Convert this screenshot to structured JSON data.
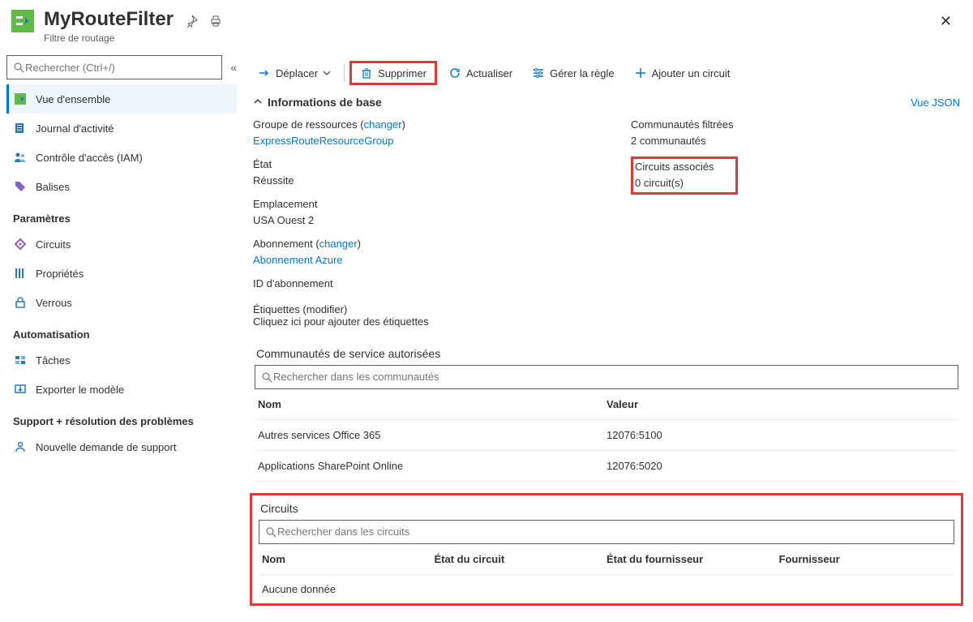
{
  "header": {
    "title": "MyRouteFilter",
    "subtitle": "Filtre de routage"
  },
  "sidebar": {
    "search_placeholder": "Rechercher (Ctrl+/)",
    "items": {
      "overview": "Vue d'ensemble",
      "activity": "Journal d'activité",
      "iam": "Contrôle d'accès (IAM)",
      "tags": "Balises"
    },
    "section_params": "Paramètres",
    "params": {
      "circuits": "Circuits",
      "properties": "Propriétés",
      "locks": "Verrous"
    },
    "section_auto": "Automatisation",
    "auto": {
      "tasks": "Tâches",
      "export": "Exporter le modèle"
    },
    "section_support": "Support + résolution des problèmes",
    "support": {
      "new": "Nouvelle demande de support"
    }
  },
  "toolbar": {
    "move": "Déplacer",
    "delete": "Supprimer",
    "refresh": "Actualiser",
    "manage_rule": "Gérer la règle",
    "add_circuit": "Ajouter un circuit"
  },
  "essentials": {
    "title": "Informations de base",
    "json_link": "Vue JSON",
    "rg_label": "Groupe de ressources (",
    "rg_change": "changer",
    "rg_close": ")",
    "rg_value": "ExpressRouteResourceGroup",
    "state_label": "État",
    "state_value": "Réussite",
    "location_label": "Emplacement",
    "location_value": "USA Ouest 2",
    "sub_label": "Abonnement (",
    "sub_change": "changer",
    "sub_close": ")",
    "sub_value": "Abonnement Azure",
    "subid_label": "ID d'abonnement",
    "communities_label": "Communautés filtrées",
    "communities_value": "2 communautés",
    "circuits_label": "Circuits associés",
    "circuits_value": "0 circuit(s)",
    "tags_label": "Étiquettes (",
    "tags_edit": "modifier",
    "tags_close": ")",
    "tags_add": "Cliquez ici pour ajouter des étiquettes"
  },
  "communities_panel": {
    "title": "Communautés de service autorisées",
    "search_placeholder": "Rechercher dans les communautés",
    "col_name": "Nom",
    "col_value": "Valeur",
    "rows": [
      {
        "name": "Autres services Office 365",
        "value": "12076:5100"
      },
      {
        "name": "Applications SharePoint Online",
        "value": "12076:5020"
      }
    ]
  },
  "circuits_panel": {
    "title": "Circuits",
    "search_placeholder": "Rechercher dans les circuits",
    "col_name": "Nom",
    "col_state": "État du circuit",
    "col_provstate": "État du fournisseur",
    "col_provider": "Fournisseur",
    "no_data": "Aucune donnée"
  }
}
